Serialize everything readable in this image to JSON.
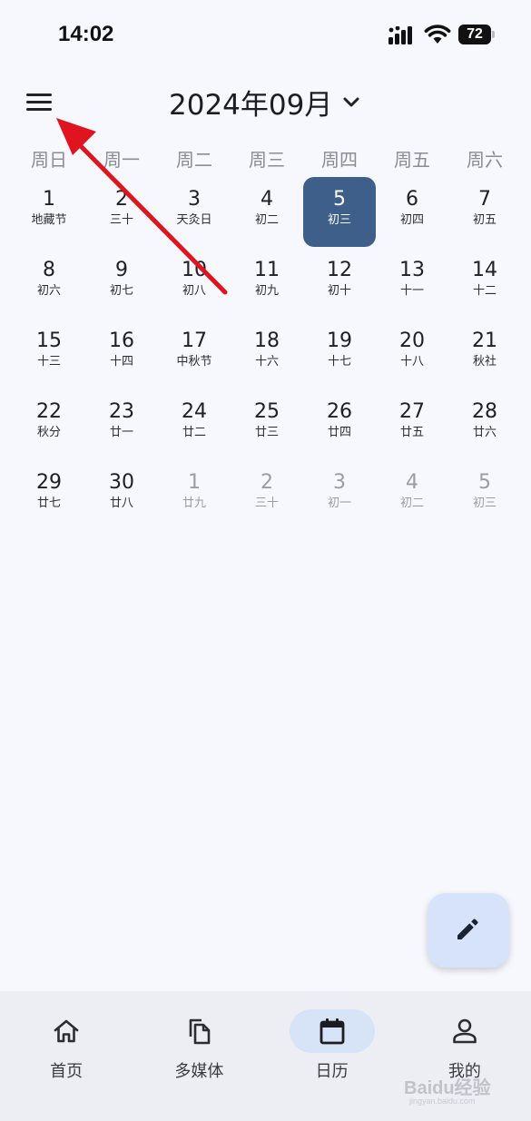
{
  "status_bar": {
    "time": "14:02",
    "battery": "72",
    "icons": [
      "signal-icon",
      "wifi-icon",
      "battery-icon"
    ]
  },
  "header": {
    "menu_icon": "menu-icon",
    "month_title": "2024年09月",
    "dropdown_icon": "chevron-down-icon"
  },
  "weekdays": [
    "周日",
    "周一",
    "周二",
    "周三",
    "周四",
    "周五",
    "周六"
  ],
  "days": [
    {
      "num": "1",
      "lunar": "地藏节",
      "other": false,
      "selected": false
    },
    {
      "num": "2",
      "lunar": "三十",
      "other": false,
      "selected": false
    },
    {
      "num": "3",
      "lunar": "天灸日",
      "other": false,
      "selected": false
    },
    {
      "num": "4",
      "lunar": "初二",
      "other": false,
      "selected": false
    },
    {
      "num": "5",
      "lunar": "初三",
      "other": false,
      "selected": true
    },
    {
      "num": "6",
      "lunar": "初四",
      "other": false,
      "selected": false
    },
    {
      "num": "7",
      "lunar": "初五",
      "other": false,
      "selected": false
    },
    {
      "num": "8",
      "lunar": "初六",
      "other": false,
      "selected": false
    },
    {
      "num": "9",
      "lunar": "初七",
      "other": false,
      "selected": false
    },
    {
      "num": "10",
      "lunar": "初八",
      "other": false,
      "selected": false
    },
    {
      "num": "11",
      "lunar": "初九",
      "other": false,
      "selected": false
    },
    {
      "num": "12",
      "lunar": "初十",
      "other": false,
      "selected": false
    },
    {
      "num": "13",
      "lunar": "十一",
      "other": false,
      "selected": false
    },
    {
      "num": "14",
      "lunar": "十二",
      "other": false,
      "selected": false
    },
    {
      "num": "15",
      "lunar": "十三",
      "other": false,
      "selected": false
    },
    {
      "num": "16",
      "lunar": "十四",
      "other": false,
      "selected": false
    },
    {
      "num": "17",
      "lunar": "中秋节",
      "other": false,
      "selected": false
    },
    {
      "num": "18",
      "lunar": "十六",
      "other": false,
      "selected": false
    },
    {
      "num": "19",
      "lunar": "十七",
      "other": false,
      "selected": false
    },
    {
      "num": "20",
      "lunar": "十八",
      "other": false,
      "selected": false
    },
    {
      "num": "21",
      "lunar": "秋社",
      "other": false,
      "selected": false
    },
    {
      "num": "22",
      "lunar": "秋分",
      "other": false,
      "selected": false
    },
    {
      "num": "23",
      "lunar": "廿一",
      "other": false,
      "selected": false
    },
    {
      "num": "24",
      "lunar": "廿二",
      "other": false,
      "selected": false
    },
    {
      "num": "25",
      "lunar": "廿三",
      "other": false,
      "selected": false
    },
    {
      "num": "26",
      "lunar": "廿四",
      "other": false,
      "selected": false
    },
    {
      "num": "27",
      "lunar": "廿五",
      "other": false,
      "selected": false
    },
    {
      "num": "28",
      "lunar": "廿六",
      "other": false,
      "selected": false
    },
    {
      "num": "29",
      "lunar": "廿七",
      "other": false,
      "selected": false
    },
    {
      "num": "30",
      "lunar": "廿八",
      "other": false,
      "selected": false
    },
    {
      "num": "1",
      "lunar": "廿九",
      "other": true,
      "selected": false
    },
    {
      "num": "2",
      "lunar": "三十",
      "other": true,
      "selected": false
    },
    {
      "num": "3",
      "lunar": "初一",
      "other": true,
      "selected": false
    },
    {
      "num": "4",
      "lunar": "初二",
      "other": true,
      "selected": false
    },
    {
      "num": "5",
      "lunar": "初三",
      "other": true,
      "selected": false
    }
  ],
  "fab": {
    "icon": "pencil-icon"
  },
  "bottom_nav": [
    {
      "label": "首页",
      "icon": "home-icon",
      "active": false
    },
    {
      "label": "多媒体",
      "icon": "media-icon",
      "active": false
    },
    {
      "label": "日历",
      "icon": "calendar-icon",
      "active": true
    },
    {
      "label": "我的",
      "icon": "profile-icon",
      "active": false
    }
  ],
  "watermark": {
    "text": "Baidu经验",
    "sub": "jingyan.baidu.com"
  },
  "colors": {
    "background": "#f7f8fd",
    "selected_day": "#3e5f89",
    "fab": "#d6e3fb",
    "nav_bar": "#eceef4",
    "nav_active_pill": "#d7e3f7",
    "annotation_arrow": "#e0141e",
    "other_month_text": "#9a9ca6"
  }
}
